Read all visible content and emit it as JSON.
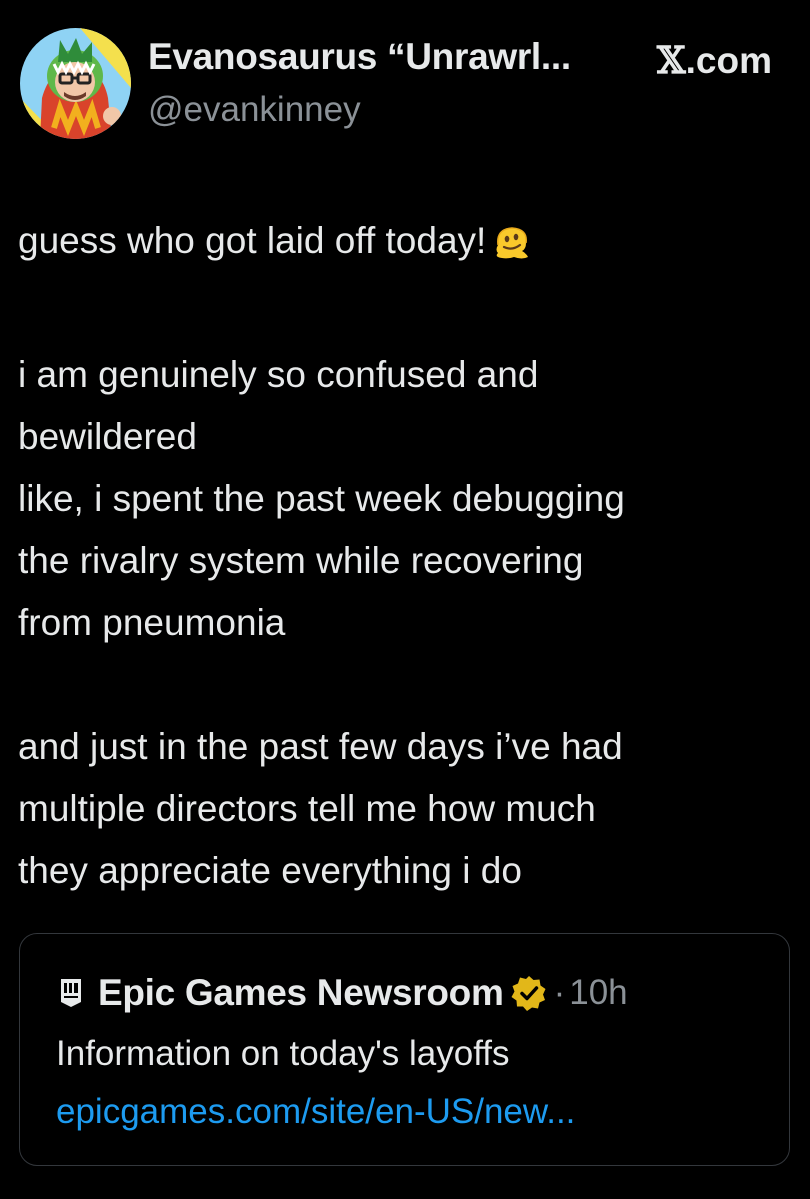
{
  "header": {
    "display_name": "Evanosaurus “Unrawrl...",
    "handle": "@evankinney",
    "brand_x": "𝕏",
    "brand_suffix": ".com",
    "avatar_icon": "dinosaur-costume-avatar-icon"
  },
  "tweet": {
    "paragraph_1": [
      "guess who got laid off today!"
    ],
    "paragraph_1_emoji": "melting-face-emoji-icon",
    "paragraph_2": [
      "i am genuinely so confused and",
      "bewildered",
      "like, i spent the past week debugging",
      "the rivalry system while recovering",
      "from pneumonia"
    ],
    "paragraph_3": [
      "and just in the past few days i’ve had",
      "multiple directors tell me how much",
      "they appreciate everything i do"
    ]
  },
  "quote": {
    "author": "Epic Games Newsroom",
    "avatar_icon": "epic-games-logo-icon",
    "badge_icon": "verified-badge-icon",
    "separator": "·",
    "time": "10h",
    "text": "Information on today's layoffs",
    "link": "epicgames.com/site/en-US/new..."
  },
  "colors": {
    "background": "#000000",
    "primary_text": "#e7e9ea",
    "secondary_text": "#8b9197",
    "link": "#1d9bf0",
    "card_border": "#33373c",
    "verified_gold": "#e2b719"
  }
}
